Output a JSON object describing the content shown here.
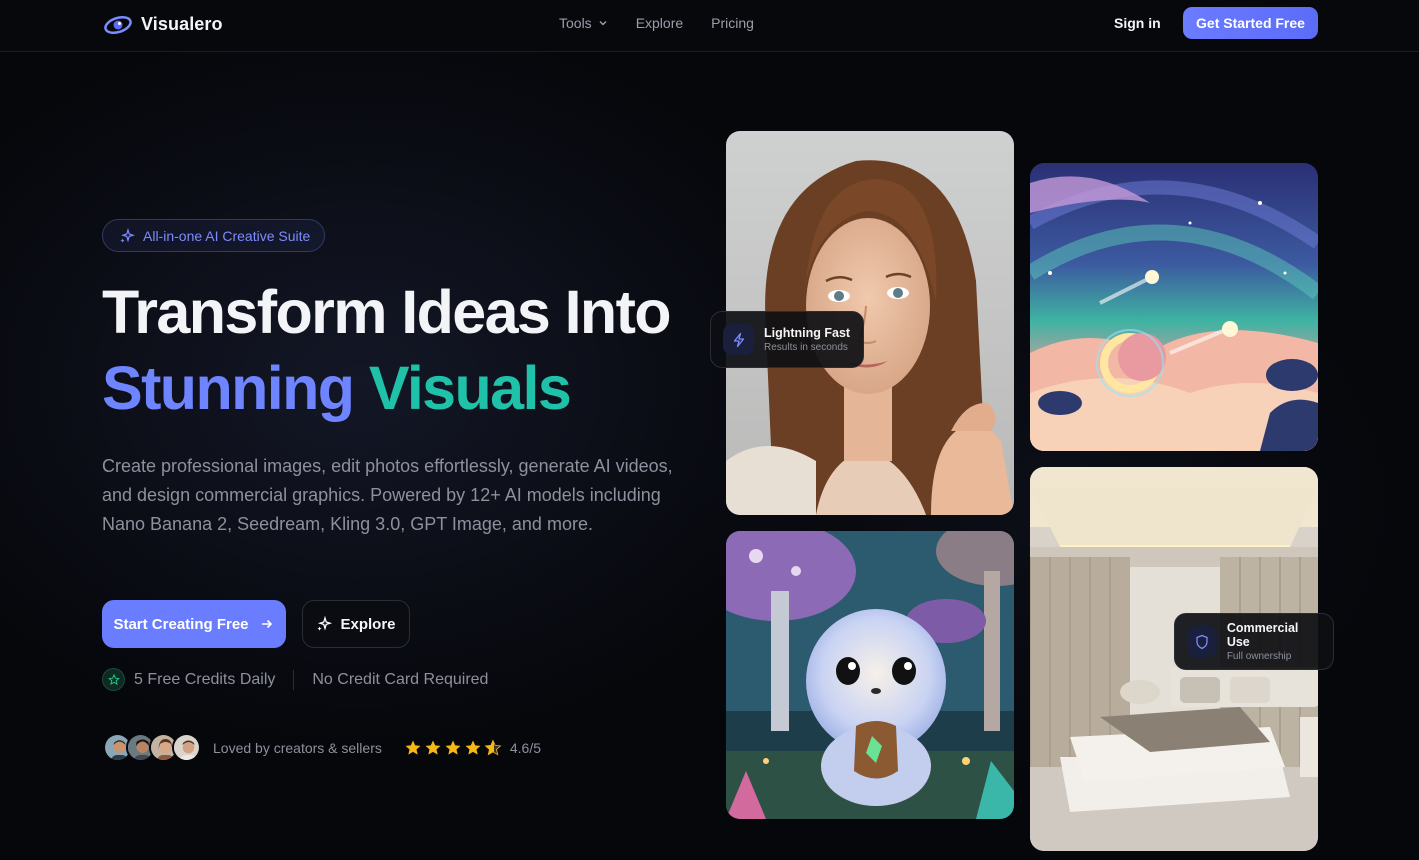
{
  "nav": {
    "brand": "Visualero",
    "links": [
      {
        "label": "Tools",
        "has_dropdown": true
      },
      {
        "label": "Explore"
      },
      {
        "label": "Pricing"
      }
    ],
    "signin_label": "Sign in",
    "cta_label": "Get Started Free"
  },
  "hero": {
    "badge": "All-in-one AI Creative Suite",
    "headline_line1": "Transform Ideas Into",
    "headline_word1": "Stunning",
    "headline_word2": "Visuals",
    "description": "Create professional images, edit photos effortlessly, generate AI videos, and design commercial graphics. Powered by 12+ AI models including Nano Banana 2, Seedream, Kling 3.0, GPT Image, and more.",
    "primary_button": "Start Creating Free",
    "secondary_button": "Explore",
    "perk1": "5 Free Credits Daily",
    "perk2": "No Credit Card Required",
    "social_text": "Loved by creators & sellers",
    "rating": "4.6/5",
    "rating_value": 4.6,
    "stars_max": 5
  },
  "floaters": {
    "fast_title": "Lightning Fast",
    "fast_sub": "Results in seconds",
    "commercial_title": "Commercial Use",
    "commercial_sub": "Full ownership"
  },
  "colors": {
    "accent": "#6a7dff",
    "teal": "#20c1a9",
    "star": "#f5b817",
    "background": "#06070b"
  },
  "gallery": {
    "images": [
      "portrait-photo",
      "fantasy-night-sky",
      "cute-creature",
      "bedroom-interior"
    ]
  }
}
